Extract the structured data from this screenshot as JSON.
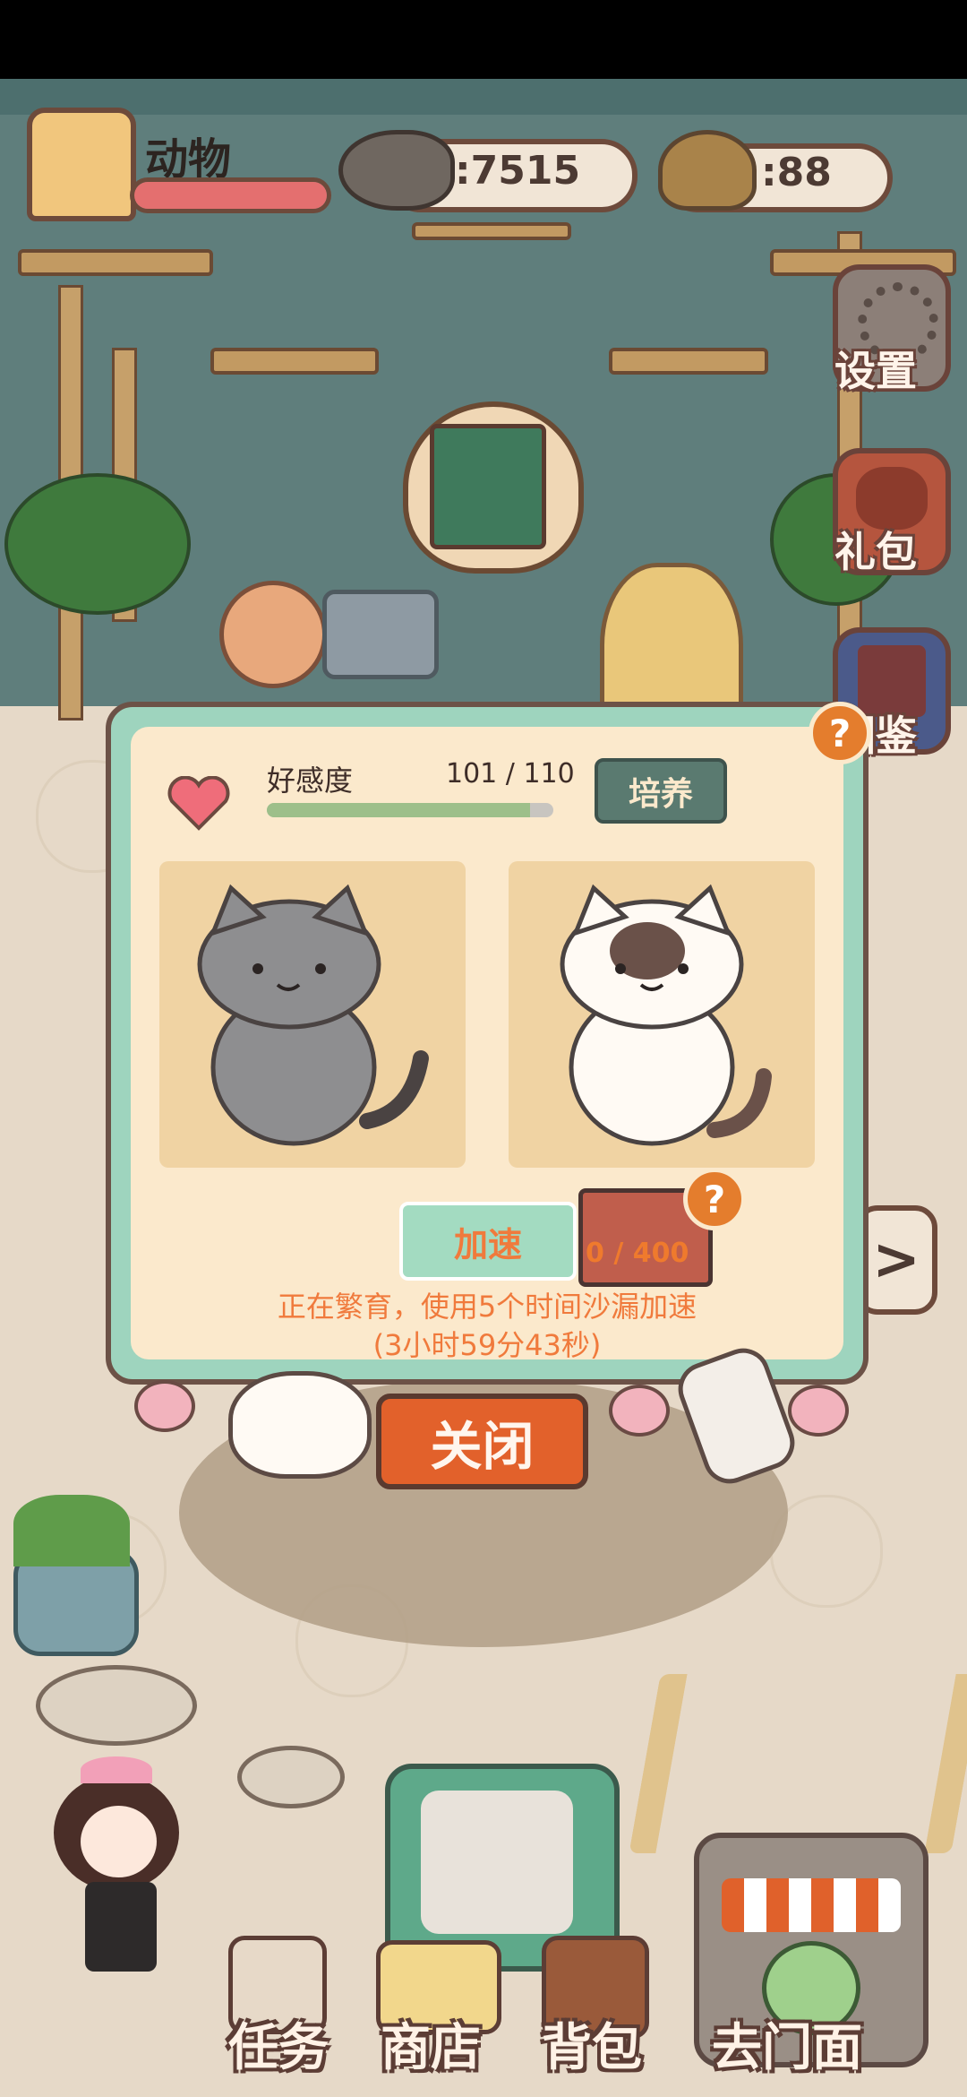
{
  "hud": {
    "animal_label": "动物",
    "animal_progress": 1.0,
    "fish_count": ":7515",
    "poop_count": ":88"
  },
  "side_buttons": {
    "settings": "设置",
    "gift": "礼包",
    "collection": "图鉴"
  },
  "modal": {
    "affection_label": "好感度",
    "affection_value": "101 / 110",
    "affection_current": 101,
    "affection_max": 110,
    "train_button": "培养",
    "help_mark": "?",
    "speedup_button": "加速",
    "hourglass_count": "0 / 400",
    "breeding_status": "正在繁育，使用5个时间沙漏加速",
    "breeding_timer": "(3小时59分43秒)"
  },
  "close_button": "关闭",
  "next_arrow": ">",
  "bottom_nav": {
    "tasks": "任务",
    "shop": "商店",
    "bag": "背包",
    "storefront": "去门面"
  },
  "colors": {
    "accent_orange": "#e2612b",
    "modal_frame": "#9ed4be",
    "panel_bg": "#fbe9cc",
    "affection_bar": "#9dbf8a",
    "text_orange": "#f07a3c"
  }
}
